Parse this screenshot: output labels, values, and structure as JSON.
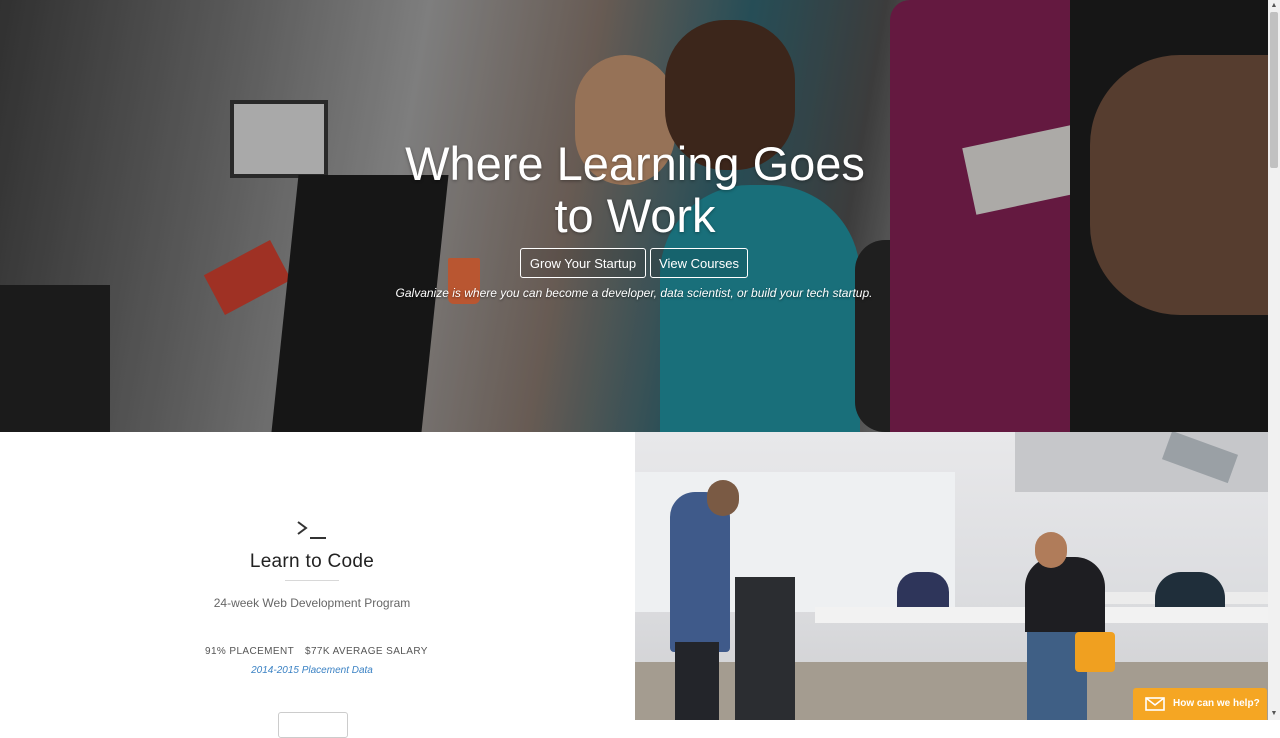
{
  "hero": {
    "title": "Where Learning Goes to Work",
    "buttons": {
      "startup": "Grow Your Startup",
      "courses": "View Courses"
    },
    "tagline": "Galvanize is where you can become a developer, data scientist, or build your tech startup."
  },
  "program": {
    "icon": "terminal-icon",
    "title": "Learn to Code",
    "subtitle": "24-week Web Development Program",
    "stats": {
      "placement": "91% PLACEMENT",
      "salary": "$77K AVERAGE SALARY"
    },
    "data_link": "2014-2015 Placement Data"
  },
  "chat": {
    "label": "How can we help?",
    "icon": "envelope-icon",
    "color": "#f5a623"
  },
  "colors": {
    "link": "#3b82c4",
    "text": "#222222"
  }
}
